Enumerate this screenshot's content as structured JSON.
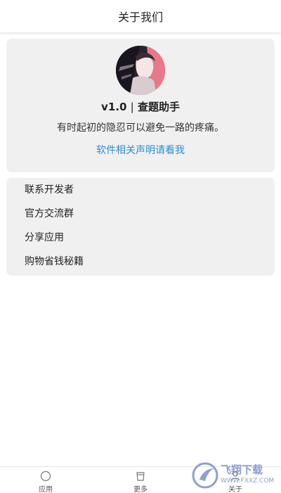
{
  "header": {
    "title": "关于我们"
  },
  "about": {
    "avatar_icon": "avatar-illustration",
    "version": "v1.0",
    "separator": "|",
    "app_name": "查题助手",
    "slogan": "有时起初的隐忍可以避免一路的疼痛。",
    "disclaimer_link": "软件相关声明请看我",
    "link_color": "#2a8fd6"
  },
  "menu": {
    "items": [
      {
        "label": "联系开发者"
      },
      {
        "label": "官方交流群"
      },
      {
        "label": "分享应用"
      },
      {
        "label": "购物省钱秘籍"
      }
    ]
  },
  "bottom_nav": {
    "items": [
      {
        "label": "应用",
        "icon": "circle-icon"
      },
      {
        "label": "更多",
        "icon": "cup-icon"
      },
      {
        "label": "关于",
        "icon": "user-icon"
      }
    ]
  },
  "watermark": {
    "brand": "飞翔下载",
    "url": "WWW.FXXZ.COM"
  }
}
